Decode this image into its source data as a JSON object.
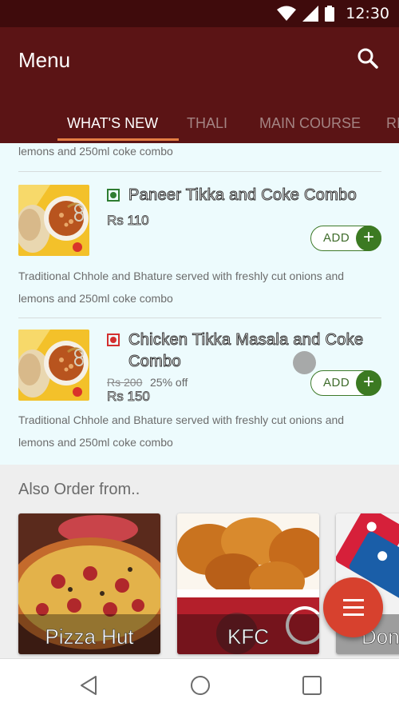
{
  "status_bar": {
    "time": "12:30"
  },
  "app_bar": {
    "title": "Menu"
  },
  "tabs": [
    {
      "label": "WHAT'S NEW",
      "active": true
    },
    {
      "label": "THALI",
      "active": false
    },
    {
      "label": "MAIN COURSE",
      "active": false
    },
    {
      "label": "RI",
      "active": false
    }
  ],
  "menu": {
    "top_desc_line2": "lemons and 250ml coke combo",
    "items": [
      {
        "name_line1": "Paneer Tikka and Coke Combo",
        "name_line2": "",
        "type": "veg",
        "price": "Rs 110",
        "add_label": "ADD",
        "desc_line1": "Traditional Chhole and Bhature served with freshly cut onions and",
        "desc_line2": "lemons and 250ml coke combo"
      },
      {
        "name_line1": "Chicken Tikka Masala and Coke",
        "name_line2": "Combo",
        "type": "non-veg",
        "old_price": "Rs 200",
        "discount": "25% off",
        "price": "Rs 150",
        "add_label": "ADD",
        "desc_line1": "Traditional Chhole and Bhature served with freshly cut onions and",
        "desc_line2": "lemons and 250ml coke combo"
      }
    ]
  },
  "also_order": {
    "title": "Also Order from..",
    "restaurants": [
      {
        "name": "Pizza Hut"
      },
      {
        "name": "KFC"
      },
      {
        "name": "Don"
      }
    ]
  },
  "colors": {
    "status_bar": "#3f0b0c",
    "app_bar": "#5b1415",
    "tab_indicator": "#e57e43",
    "list_bg": "#edfbfd",
    "add_green": "#3c7a22",
    "fab": "#d7412e",
    "veg": "#2e7d32",
    "non_veg": "#d32f2f"
  },
  "icons": {
    "status": [
      "wifi-icon",
      "signal-icon",
      "battery-icon"
    ],
    "app_bar": "search-icon",
    "fab": "menu-icon",
    "nav": [
      "back-icon",
      "home-icon",
      "recents-icon"
    ]
  }
}
